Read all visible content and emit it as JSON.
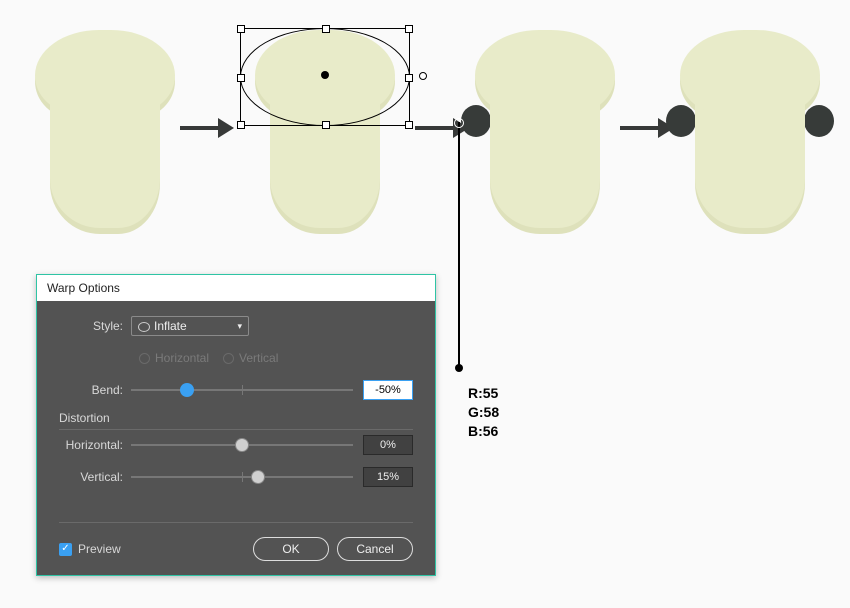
{
  "dialog": {
    "title": "Warp Options",
    "style_label": "Style:",
    "style_value": "Inflate",
    "orient_h": "Horizontal",
    "orient_v": "Vertical",
    "bend_label": "Bend:",
    "bend_value": "-50%",
    "distortion_head": "Distortion",
    "dist_h_label": "Horizontal:",
    "dist_h_value": "0%",
    "dist_v_label": "Vertical:",
    "dist_v_value": "15%",
    "preview_label": "Preview",
    "ok_label": "OK",
    "cancel_label": "Cancel"
  },
  "rgb": {
    "r": "R:55",
    "g": "G:58",
    "b": "B:56"
  }
}
